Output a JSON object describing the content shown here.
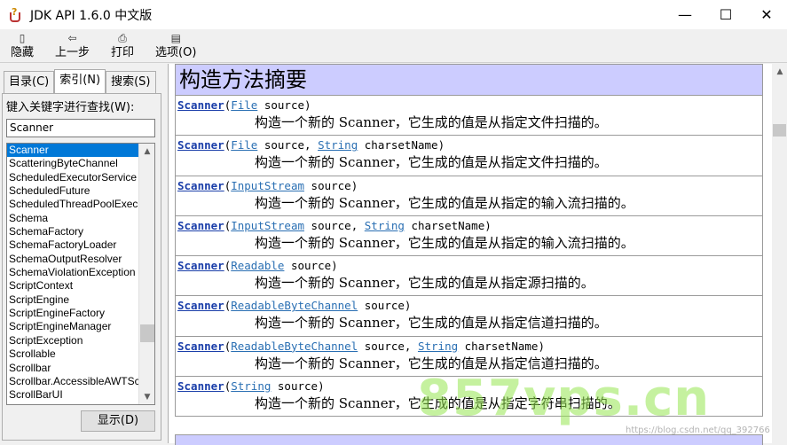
{
  "window": {
    "title": "JDK API 1.6.0 中文版",
    "controls": {
      "minimize": "—",
      "maximize": "☐",
      "close": "✕"
    }
  },
  "toolbar": {
    "items": [
      {
        "label": "隐藏",
        "icon": "hide-icon"
      },
      {
        "label": "上一步",
        "icon": "back-arrow-icon"
      },
      {
        "label": "打印",
        "icon": "printer-icon"
      },
      {
        "label": "选项(O)",
        "icon": "options-icon"
      }
    ]
  },
  "left_pane": {
    "tabs": [
      {
        "label": "目录(C)",
        "active": false
      },
      {
        "label": "索引(N)",
        "active": true
      },
      {
        "label": "搜索(S)",
        "active": false
      }
    ],
    "keyword_label": "键入关键字进行查找(W):",
    "keyword_value": "Scanner",
    "list_items": [
      "Scanner",
      "ScatteringByteChannel",
      "ScheduledExecutorService",
      "ScheduledFuture",
      "ScheduledThreadPoolExecutor",
      "Schema",
      "SchemaFactory",
      "SchemaFactoryLoader",
      "SchemaOutputResolver",
      "SchemaViolationException",
      "ScriptContext",
      "ScriptEngine",
      "ScriptEngineFactory",
      "ScriptEngineManager",
      "ScriptException",
      "Scrollable",
      "Scrollbar",
      "Scrollbar.AccessibleAWTScrollBar",
      "ScrollBarUI"
    ],
    "selected_item": "Scanner",
    "show_button": "显示(D)"
  },
  "content": {
    "summary_title": "构造方法摘要",
    "constructors": [
      {
        "name": "Scanner",
        "params": [
          {
            "type": "File",
            "name": "source"
          }
        ],
        "description": "构造一个新的 Scanner，它生成的值是从指定文件扫描的。"
      },
      {
        "name": "Scanner",
        "params": [
          {
            "type": "File",
            "name": "source"
          },
          {
            "type": "String",
            "name": "charsetName"
          }
        ],
        "description": "构造一个新的 Scanner，它生成的值是从指定文件扫描的。"
      },
      {
        "name": "Scanner",
        "params": [
          {
            "type": "InputStream",
            "name": "source"
          }
        ],
        "description": "构造一个新的 Scanner，它生成的值是从指定的输入流扫描的。"
      },
      {
        "name": "Scanner",
        "params": [
          {
            "type": "InputStream",
            "name": "source"
          },
          {
            "type": "String",
            "name": "charsetName"
          }
        ],
        "description": "构造一个新的 Scanner，它生成的值是从指定的输入流扫描的。"
      },
      {
        "name": "Scanner",
        "params": [
          {
            "type": "Readable",
            "name": "source"
          }
        ],
        "description": "构造一个新的 Scanner，它生成的值是从指定源扫描的。"
      },
      {
        "name": "Scanner",
        "params": [
          {
            "type": "ReadableByteChannel",
            "name": "source"
          }
        ],
        "description": "构造一个新的 Scanner，它生成的值是从指定信道扫描的。"
      },
      {
        "name": "Scanner",
        "params": [
          {
            "type": "ReadableByteChannel",
            "name": "source"
          },
          {
            "type": "String",
            "name": "charsetName"
          }
        ],
        "description": "构造一个新的 Scanner，它生成的值是从指定信道扫描的。"
      },
      {
        "name": "Scanner",
        "params": [
          {
            "type": "String",
            "name": "source"
          }
        ],
        "description": "构造一个新的 Scanner，它生成的值是从指定字符串扫描的。"
      }
    ]
  },
  "watermark": {
    "text": "857vps.cn",
    "credit": "https://blog.csdn.net/qq_392766"
  },
  "colors": {
    "accent": "#0078d7",
    "header_bg": "#ccccff",
    "link": "#1a3ea9"
  }
}
